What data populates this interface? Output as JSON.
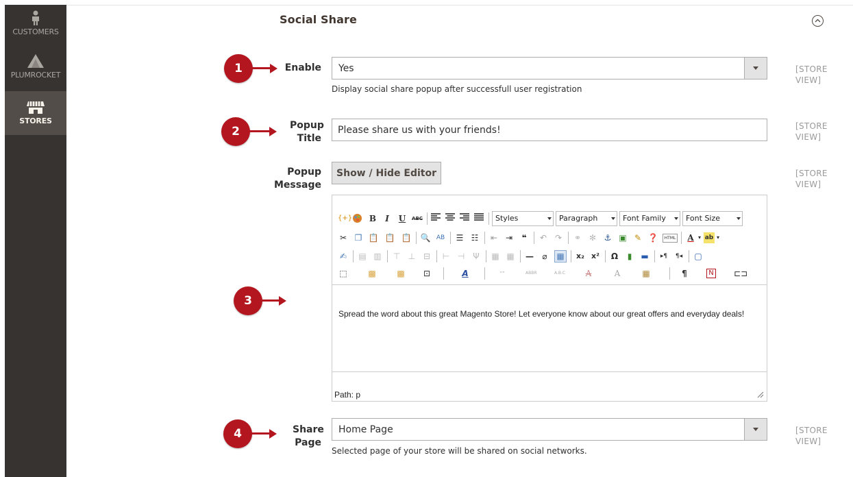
{
  "sidebar": {
    "items": [
      {
        "label": "CUSTOMERS",
        "icon": "person-icon",
        "active": false
      },
      {
        "label": "PLUMROCKET",
        "icon": "plumrocket-logo-icon",
        "active": false
      },
      {
        "label": "STORES",
        "icon": "store-icon",
        "active": true
      }
    ]
  },
  "section": {
    "title": "Social Share",
    "collapse_icon": "chevron-up-circle-icon"
  },
  "scope_label": "[STORE VIEW]",
  "fields": {
    "enable": {
      "label": "Enable",
      "value": "Yes",
      "note": "Display social share popup after successfull user registration",
      "scope": "[STORE VIEW]"
    },
    "popup_title": {
      "label": "Popup Title",
      "value": "Please share us with your friends!",
      "scope": "[STORE VIEW]"
    },
    "popup_message": {
      "label": "Popup Message",
      "button": "Show / Hide Editor",
      "scope": "[STORE VIEW]",
      "editor": {
        "dropdowns": [
          "Styles",
          "Paragraph",
          "Font Family",
          "Font Size"
        ],
        "content": "Spread the word about this great Magento Store! Let everyone know about our great offers and everyday deals!",
        "path": "Path: p"
      }
    },
    "share_page": {
      "label": "Share Page",
      "value": "Home Page",
      "note": "Selected page of your store will be shared on social networks.",
      "scope": "[STORE VIEW]"
    }
  },
  "callouts": [
    "1",
    "2",
    "3",
    "4"
  ],
  "colors": {
    "sidebar_bg": "#373330",
    "sidebar_active": "#524d49",
    "callout_red": "#b3161e"
  }
}
